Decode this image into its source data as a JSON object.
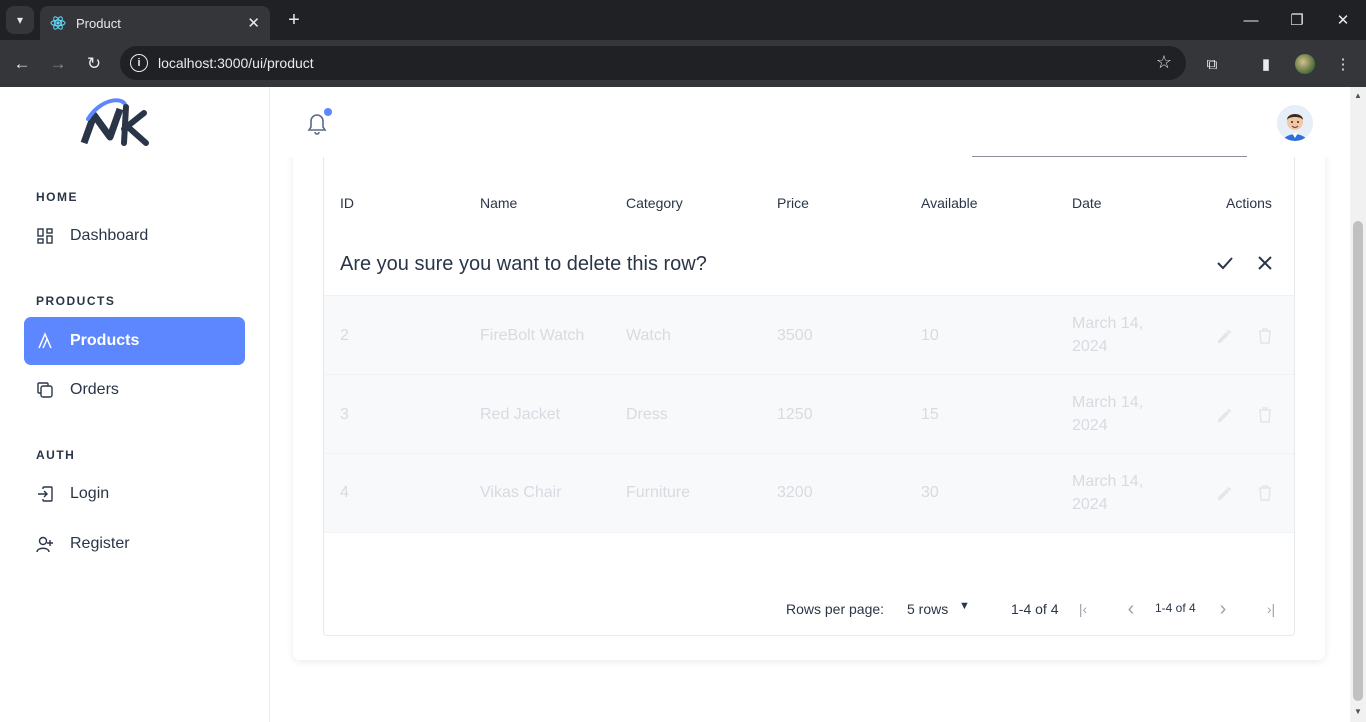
{
  "browser": {
    "tab_title": "Product",
    "url": "localhost:3000/ui/product"
  },
  "sidebar": {
    "sections": [
      {
        "label": "HOME"
      },
      {
        "label": "PRODUCTS"
      },
      {
        "label": "AUTH"
      }
    ],
    "items": [
      {
        "label": "Dashboard",
        "icon": "dashboard-icon"
      },
      {
        "label": "Products",
        "icon": "products-icon",
        "active": true
      },
      {
        "label": "Orders",
        "icon": "orders-icon"
      },
      {
        "label": "Login",
        "icon": "login-icon"
      },
      {
        "label": "Register",
        "icon": "register-icon"
      }
    ],
    "accent": "#5d87ff"
  },
  "table": {
    "columns": [
      "ID",
      "Name",
      "Category",
      "Price",
      "Available",
      "Date",
      "Actions"
    ],
    "confirm_text": "Are you sure you want to delete this row?",
    "rows": [
      {
        "id": "2",
        "name": "FireBolt Watch",
        "category": "Watch",
        "price": "3500",
        "available": "10",
        "date_line1": "March 14,",
        "date_line2": "2024"
      },
      {
        "id": "3",
        "name": "Red Jacket",
        "category": "Dress",
        "price": "1250",
        "available": "15",
        "date_line1": "March 14,",
        "date_line2": "2024"
      },
      {
        "id": "4",
        "name": "Vikas Chair",
        "category": "Furniture",
        "price": "3200",
        "available": "30",
        "date_line1": "March 14,",
        "date_line2": "2024"
      }
    ]
  },
  "pagination": {
    "rows_per_page_label": "Rows per page:",
    "rows_per_page_value": "5 rows",
    "range": "1-4 of 4",
    "range_small": "1-4 of 4"
  }
}
